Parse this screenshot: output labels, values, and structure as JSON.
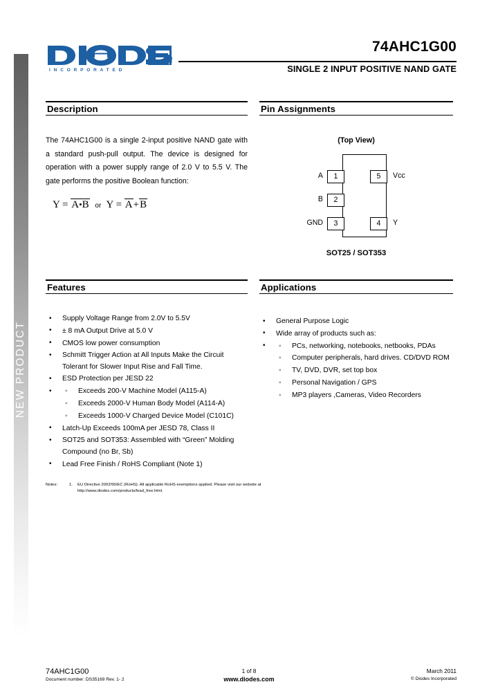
{
  "side_tab": {
    "label": "NEW PRODUCT"
  },
  "header": {
    "logo_text": "DIODES",
    "logo_subtext": "INCORPORATED",
    "part_number": "74AHC1G00",
    "subtitle": "SINGLE 2 INPUT POSITIVE NAND GATE",
    "brand_color": "#1d5fa3"
  },
  "description": {
    "heading": "Description",
    "body": "The 74AHC1G00 is a single 2-input positive NAND gate with a standard push-pull output. The device is designed for operation with a power supply range of 2.0 V to 5.5 V. The gate performs the positive Boolean function:",
    "formula": {
      "lhs1": "Y",
      "eq1": "=",
      "term1_a": "A",
      "term1_dot": "•",
      "term1_b": "B",
      "or": "or",
      "lhs2": "Y",
      "eq2": "=",
      "term2_a": "A",
      "term2_plus": "+",
      "term2_b": "B"
    }
  },
  "pin_assignments": {
    "heading": "Pin Assignments",
    "view_label": "(Top View)",
    "package_label": "SOT25 / SOT353",
    "left_pins": [
      {
        "number": "1",
        "name": "A"
      },
      {
        "number": "2",
        "name": "B"
      },
      {
        "number": "3",
        "name": "GND"
      }
    ],
    "right_pins": [
      {
        "number": "5",
        "name": "Vcc"
      },
      {
        "number": "4",
        "name": "Y"
      }
    ]
  },
  "features": {
    "heading": "Features",
    "items": [
      {
        "text": "Supply Voltage Range from 2.0V  to 5.5V"
      },
      {
        "text": "± 8 mA Output Drive at 5.0 V"
      },
      {
        "text": "CMOS low power consumption"
      },
      {
        "text": "Schmitt Trigger Action at All Inputs Make the Circuit Tolerant for Slower Input Rise and Fall Time."
      },
      {
        "text": "ESD Protection per JESD 22",
        "subitems": [
          "Exceeds 200-V Machine Model (A115-A)",
          "Exceeds 2000-V Human Body Model (A114-A)",
          "Exceeds 1000-V Charged Device Model (C101C)"
        ]
      },
      {
        "text": "Latch-Up Exceeds 100mA per JESD 78, Class II"
      },
      {
        "text": "SOT25 and SOT353: Assembled with “Green” Molding Compound (no Br, Sb)"
      },
      {
        "text": "Lead Free Finish / RoHS Compliant (Note 1)"
      }
    ]
  },
  "applications": {
    "heading": "Applications",
    "items": [
      {
        "text": "General Purpose Logic"
      },
      {
        "text": "Wide array of products such as:",
        "subitems": [
          "PCs, networking, notebooks, netbooks, PDAs",
          "Computer peripherals, hard drives. CD/DVD ROM",
          "TV, DVD, DVR, set top box",
          "Personal Navigation / GPS",
          "MP3 players ,Cameras, Video Recorders"
        ]
      }
    ]
  },
  "notes": {
    "label": "Notes:",
    "number": "1.",
    "line1": "EU Directive 2002/95/EC (RoHS). All applicable RoHS exemptions applied. Please visit our website at",
    "line2": "http://www.diodes.com/products/lead_free.html."
  },
  "footer": {
    "part_number": "74AHC1G00",
    "document_number": "Document number: DS35169 Rev. 1- 2",
    "page": "1 of 8",
    "url": "www.diodes.com",
    "date": "March 2011",
    "copyright": "© Diodes Incorporated"
  }
}
